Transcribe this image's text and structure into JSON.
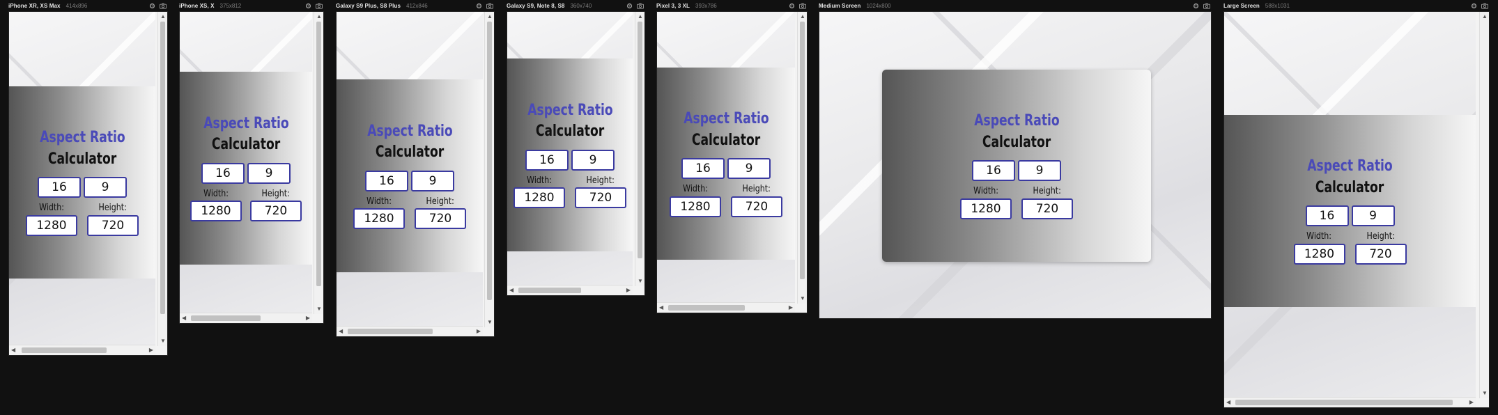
{
  "devices": [
    {
      "name": "iPhone XR, XS Max",
      "size": "414x896"
    },
    {
      "name": "iPhone XS, X",
      "size": "375x812"
    },
    {
      "name": "Galaxy S9 Plus, S8 Plus",
      "size": "412x846"
    },
    {
      "name": "Galaxy S9, Note 8, S8",
      "size": "360x740"
    },
    {
      "name": "Pixel 3, 3 XL",
      "size": "393x786"
    },
    {
      "name": "Medium Screen",
      "size": "1024x800"
    },
    {
      "name": "Large Screen",
      "size": "588x1031"
    }
  ],
  "app": {
    "title": "Aspect Ratio",
    "subtitle": "Calculator",
    "ratio_w": "16",
    "ratio_h": "9",
    "width_label": "Width:",
    "height_label": "Height:",
    "width_value": "1280",
    "height_value": "720"
  },
  "icons": {
    "settings": "gear-icon",
    "screenshot": "camera-icon"
  },
  "colors": {
    "title": "#4a4ab8",
    "input_border": "#3a3aa0",
    "background": "#111111"
  }
}
